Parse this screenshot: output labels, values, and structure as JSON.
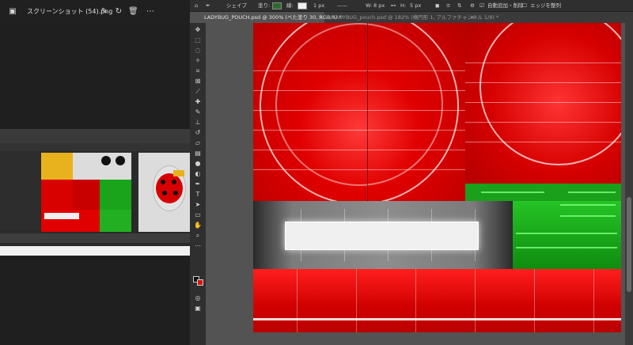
{
  "viewer": {
    "filename": "スクリーンショット (54).png",
    "icons": [
      "edit-icon",
      "rotate-icon",
      "delete-icon",
      "more-icon"
    ],
    "more_glyph": "⋯"
  },
  "photoshop": {
    "options": {
      "shape_mode": "シェイプ",
      "fill_label": "塗り:",
      "stroke_label": "線:",
      "stroke_width": "1 px",
      "width_label": "W:",
      "width_value": "8 px",
      "height_label": "H:",
      "height_value": "5 px",
      "auto_add_delete": "自動追加・削除",
      "align_edges": "エッジを整列"
    },
    "tabs": [
      {
        "label": "LADYBUG_POUCH.psd @ 300% (べた塗り 30, RGB/8) *",
        "active": true
      },
      {
        "label": "LADYBUG_pouch.psd @ 182% (楕円形 1, アルファチャンネル 1/8) *",
        "active": false
      }
    ],
    "tab_close_glyph": "×",
    "colors": {
      "foreground": "#111111",
      "background": "#d81414"
    }
  }
}
